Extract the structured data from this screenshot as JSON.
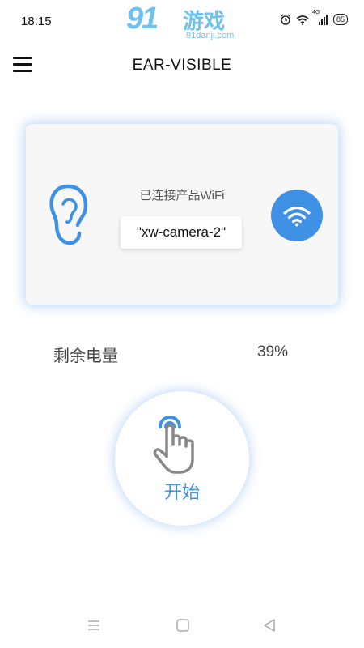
{
  "status_bar": {
    "time": "18:15",
    "network": "4G",
    "battery": "85",
    "icons": [
      "alarm-icon",
      "wifi-icon",
      "signal-icon",
      "battery-icon"
    ]
  },
  "watermark": {
    "logo": "91",
    "name": "游戏",
    "url": "91danji.com"
  },
  "header": {
    "title": "EAR-VISIBLE",
    "menu_icon": "hamburger-icon"
  },
  "connection_card": {
    "label": "已连接产品WiFi",
    "ssid": "\"xw-camera-2\"",
    "left_icon": "ear-icon",
    "right_icon": "wifi-icon"
  },
  "battery_row": {
    "label": "剩余电量",
    "value": "39%"
  },
  "start": {
    "label": "开始",
    "icon": "tap-hand-icon"
  },
  "nav_bar": {
    "items": [
      "menu-nav-icon",
      "home-nav-icon",
      "back-nav-icon"
    ]
  },
  "colors": {
    "accent": "#3f91e6",
    "watermark": "#6ec2ef",
    "card_bg": "#f7f7f7"
  }
}
